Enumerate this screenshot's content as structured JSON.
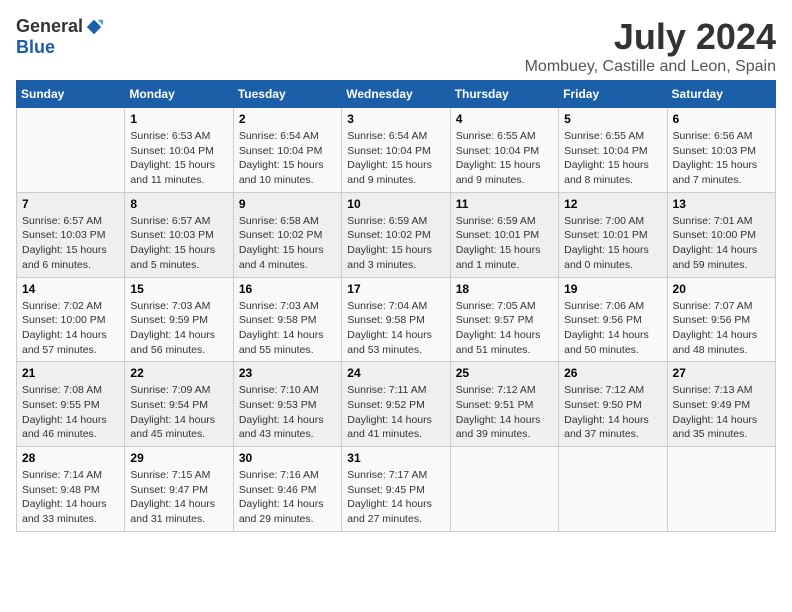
{
  "logo": {
    "general": "General",
    "blue": "Blue"
  },
  "title": "July 2024",
  "location": "Mombuey, Castille and Leon, Spain",
  "headers": [
    "Sunday",
    "Monday",
    "Tuesday",
    "Wednesday",
    "Thursday",
    "Friday",
    "Saturday"
  ],
  "weeks": [
    [
      {
        "day": "",
        "sunrise": "",
        "sunset": "",
        "daylight": ""
      },
      {
        "day": "1",
        "sunrise": "Sunrise: 6:53 AM",
        "sunset": "Sunset: 10:04 PM",
        "daylight": "Daylight: 15 hours and 11 minutes."
      },
      {
        "day": "2",
        "sunrise": "Sunrise: 6:54 AM",
        "sunset": "Sunset: 10:04 PM",
        "daylight": "Daylight: 15 hours and 10 minutes."
      },
      {
        "day": "3",
        "sunrise": "Sunrise: 6:54 AM",
        "sunset": "Sunset: 10:04 PM",
        "daylight": "Daylight: 15 hours and 9 minutes."
      },
      {
        "day": "4",
        "sunrise": "Sunrise: 6:55 AM",
        "sunset": "Sunset: 10:04 PM",
        "daylight": "Daylight: 15 hours and 9 minutes."
      },
      {
        "day": "5",
        "sunrise": "Sunrise: 6:55 AM",
        "sunset": "Sunset: 10:04 PM",
        "daylight": "Daylight: 15 hours and 8 minutes."
      },
      {
        "day": "6",
        "sunrise": "Sunrise: 6:56 AM",
        "sunset": "Sunset: 10:03 PM",
        "daylight": "Daylight: 15 hours and 7 minutes."
      }
    ],
    [
      {
        "day": "7",
        "sunrise": "Sunrise: 6:57 AM",
        "sunset": "Sunset: 10:03 PM",
        "daylight": "Daylight: 15 hours and 6 minutes."
      },
      {
        "day": "8",
        "sunrise": "Sunrise: 6:57 AM",
        "sunset": "Sunset: 10:03 PM",
        "daylight": "Daylight: 15 hours and 5 minutes."
      },
      {
        "day": "9",
        "sunrise": "Sunrise: 6:58 AM",
        "sunset": "Sunset: 10:02 PM",
        "daylight": "Daylight: 15 hours and 4 minutes."
      },
      {
        "day": "10",
        "sunrise": "Sunrise: 6:59 AM",
        "sunset": "Sunset: 10:02 PM",
        "daylight": "Daylight: 15 hours and 3 minutes."
      },
      {
        "day": "11",
        "sunrise": "Sunrise: 6:59 AM",
        "sunset": "Sunset: 10:01 PM",
        "daylight": "Daylight: 15 hours and 1 minute."
      },
      {
        "day": "12",
        "sunrise": "Sunrise: 7:00 AM",
        "sunset": "Sunset: 10:01 PM",
        "daylight": "Daylight: 15 hours and 0 minutes."
      },
      {
        "day": "13",
        "sunrise": "Sunrise: 7:01 AM",
        "sunset": "Sunset: 10:00 PM",
        "daylight": "Daylight: 14 hours and 59 minutes."
      }
    ],
    [
      {
        "day": "14",
        "sunrise": "Sunrise: 7:02 AM",
        "sunset": "Sunset: 10:00 PM",
        "daylight": "Daylight: 14 hours and 57 minutes."
      },
      {
        "day": "15",
        "sunrise": "Sunrise: 7:03 AM",
        "sunset": "Sunset: 9:59 PM",
        "daylight": "Daylight: 14 hours and 56 minutes."
      },
      {
        "day": "16",
        "sunrise": "Sunrise: 7:03 AM",
        "sunset": "Sunset: 9:58 PM",
        "daylight": "Daylight: 14 hours and 55 minutes."
      },
      {
        "day": "17",
        "sunrise": "Sunrise: 7:04 AM",
        "sunset": "Sunset: 9:58 PM",
        "daylight": "Daylight: 14 hours and 53 minutes."
      },
      {
        "day": "18",
        "sunrise": "Sunrise: 7:05 AM",
        "sunset": "Sunset: 9:57 PM",
        "daylight": "Daylight: 14 hours and 51 minutes."
      },
      {
        "day": "19",
        "sunrise": "Sunrise: 7:06 AM",
        "sunset": "Sunset: 9:56 PM",
        "daylight": "Daylight: 14 hours and 50 minutes."
      },
      {
        "day": "20",
        "sunrise": "Sunrise: 7:07 AM",
        "sunset": "Sunset: 9:56 PM",
        "daylight": "Daylight: 14 hours and 48 minutes."
      }
    ],
    [
      {
        "day": "21",
        "sunrise": "Sunrise: 7:08 AM",
        "sunset": "Sunset: 9:55 PM",
        "daylight": "Daylight: 14 hours and 46 minutes."
      },
      {
        "day": "22",
        "sunrise": "Sunrise: 7:09 AM",
        "sunset": "Sunset: 9:54 PM",
        "daylight": "Daylight: 14 hours and 45 minutes."
      },
      {
        "day": "23",
        "sunrise": "Sunrise: 7:10 AM",
        "sunset": "Sunset: 9:53 PM",
        "daylight": "Daylight: 14 hours and 43 minutes."
      },
      {
        "day": "24",
        "sunrise": "Sunrise: 7:11 AM",
        "sunset": "Sunset: 9:52 PM",
        "daylight": "Daylight: 14 hours and 41 minutes."
      },
      {
        "day": "25",
        "sunrise": "Sunrise: 7:12 AM",
        "sunset": "Sunset: 9:51 PM",
        "daylight": "Daylight: 14 hours and 39 minutes."
      },
      {
        "day": "26",
        "sunrise": "Sunrise: 7:12 AM",
        "sunset": "Sunset: 9:50 PM",
        "daylight": "Daylight: 14 hours and 37 minutes."
      },
      {
        "day": "27",
        "sunrise": "Sunrise: 7:13 AM",
        "sunset": "Sunset: 9:49 PM",
        "daylight": "Daylight: 14 hours and 35 minutes."
      }
    ],
    [
      {
        "day": "28",
        "sunrise": "Sunrise: 7:14 AM",
        "sunset": "Sunset: 9:48 PM",
        "daylight": "Daylight: 14 hours and 33 minutes."
      },
      {
        "day": "29",
        "sunrise": "Sunrise: 7:15 AM",
        "sunset": "Sunset: 9:47 PM",
        "daylight": "Daylight: 14 hours and 31 minutes."
      },
      {
        "day": "30",
        "sunrise": "Sunrise: 7:16 AM",
        "sunset": "Sunset: 9:46 PM",
        "daylight": "Daylight: 14 hours and 29 minutes."
      },
      {
        "day": "31",
        "sunrise": "Sunrise: 7:17 AM",
        "sunset": "Sunset: 9:45 PM",
        "daylight": "Daylight: 14 hours and 27 minutes."
      },
      {
        "day": "",
        "sunrise": "",
        "sunset": "",
        "daylight": ""
      },
      {
        "day": "",
        "sunrise": "",
        "sunset": "",
        "daylight": ""
      },
      {
        "day": "",
        "sunrise": "",
        "sunset": "",
        "daylight": ""
      }
    ]
  ]
}
